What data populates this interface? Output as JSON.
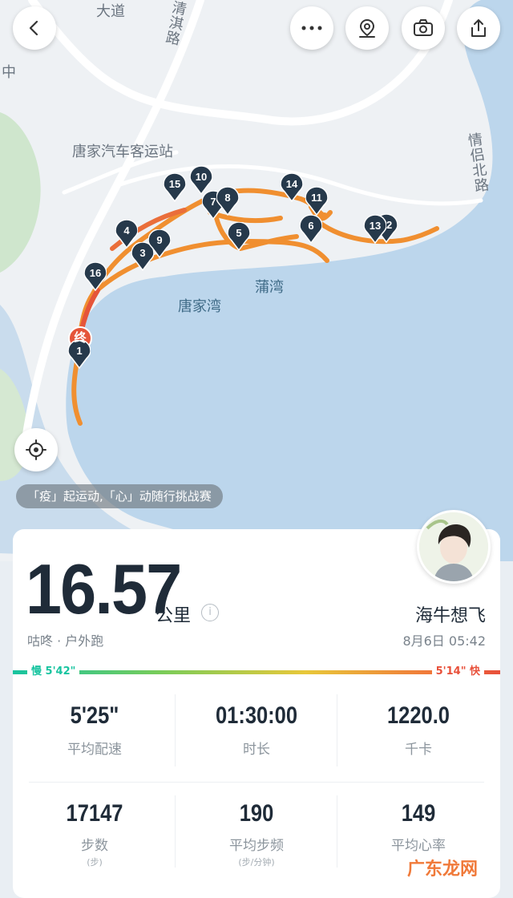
{
  "map": {
    "labels": {
      "top_road": "大道",
      "road_north": "清淇路",
      "road_east": "情侣北路",
      "bus_station": "唐家汽车客运站",
      "bay_main": "唐家湾",
      "bay_sub": "蒲湾",
      "left_edge": "中"
    },
    "markers": [
      "1",
      "2",
      "3",
      "4",
      "5",
      "6",
      "7",
      "8",
      "9",
      "10",
      "11",
      "12",
      "13",
      "14",
      "15",
      "16"
    ],
    "end_marker": "终",
    "colors": {
      "route": "#f08f30",
      "route_fast": "#e5553a",
      "water": "#bcd6ec",
      "land": "#eef1f4",
      "marker": "#26394b"
    }
  },
  "banner": {
    "text": "「疫」起运动,「心」动随行挑战赛"
  },
  "summary": {
    "distance": "16.57",
    "unit": "公里",
    "info_icon_glyph": "i",
    "subtitle": "咕咚 · 户外跑",
    "username": "海牛想飞",
    "datetime": "8月6日 05:42"
  },
  "pace_scale": {
    "slow_label": "慢 5'42\"",
    "fast_label": "5'14\" 快",
    "slow_color": "#18c4a0",
    "fast_color": "#e8503a"
  },
  "stats": [
    {
      "value": "5'25\"",
      "label": "平均配速",
      "sub": ""
    },
    {
      "value": "01:30:00",
      "label": "时长",
      "sub": ""
    },
    {
      "value": "1220.0",
      "label": "千卡",
      "sub": ""
    },
    {
      "value": "17147",
      "label": "步数",
      "sub": "(步)"
    },
    {
      "value": "190",
      "label": "平均步频",
      "sub": "(步/分钟)"
    },
    {
      "value": "149",
      "label": "平均心率",
      "sub": ""
    }
  ],
  "watermark": "广东龙网",
  "icons": {
    "back": "chevron-left-icon",
    "more": "more-dots-icon",
    "location": "location-pin-icon",
    "camera": "camera-icon",
    "share": "share-icon",
    "locate": "crosshair-icon",
    "info": "info-icon"
  }
}
